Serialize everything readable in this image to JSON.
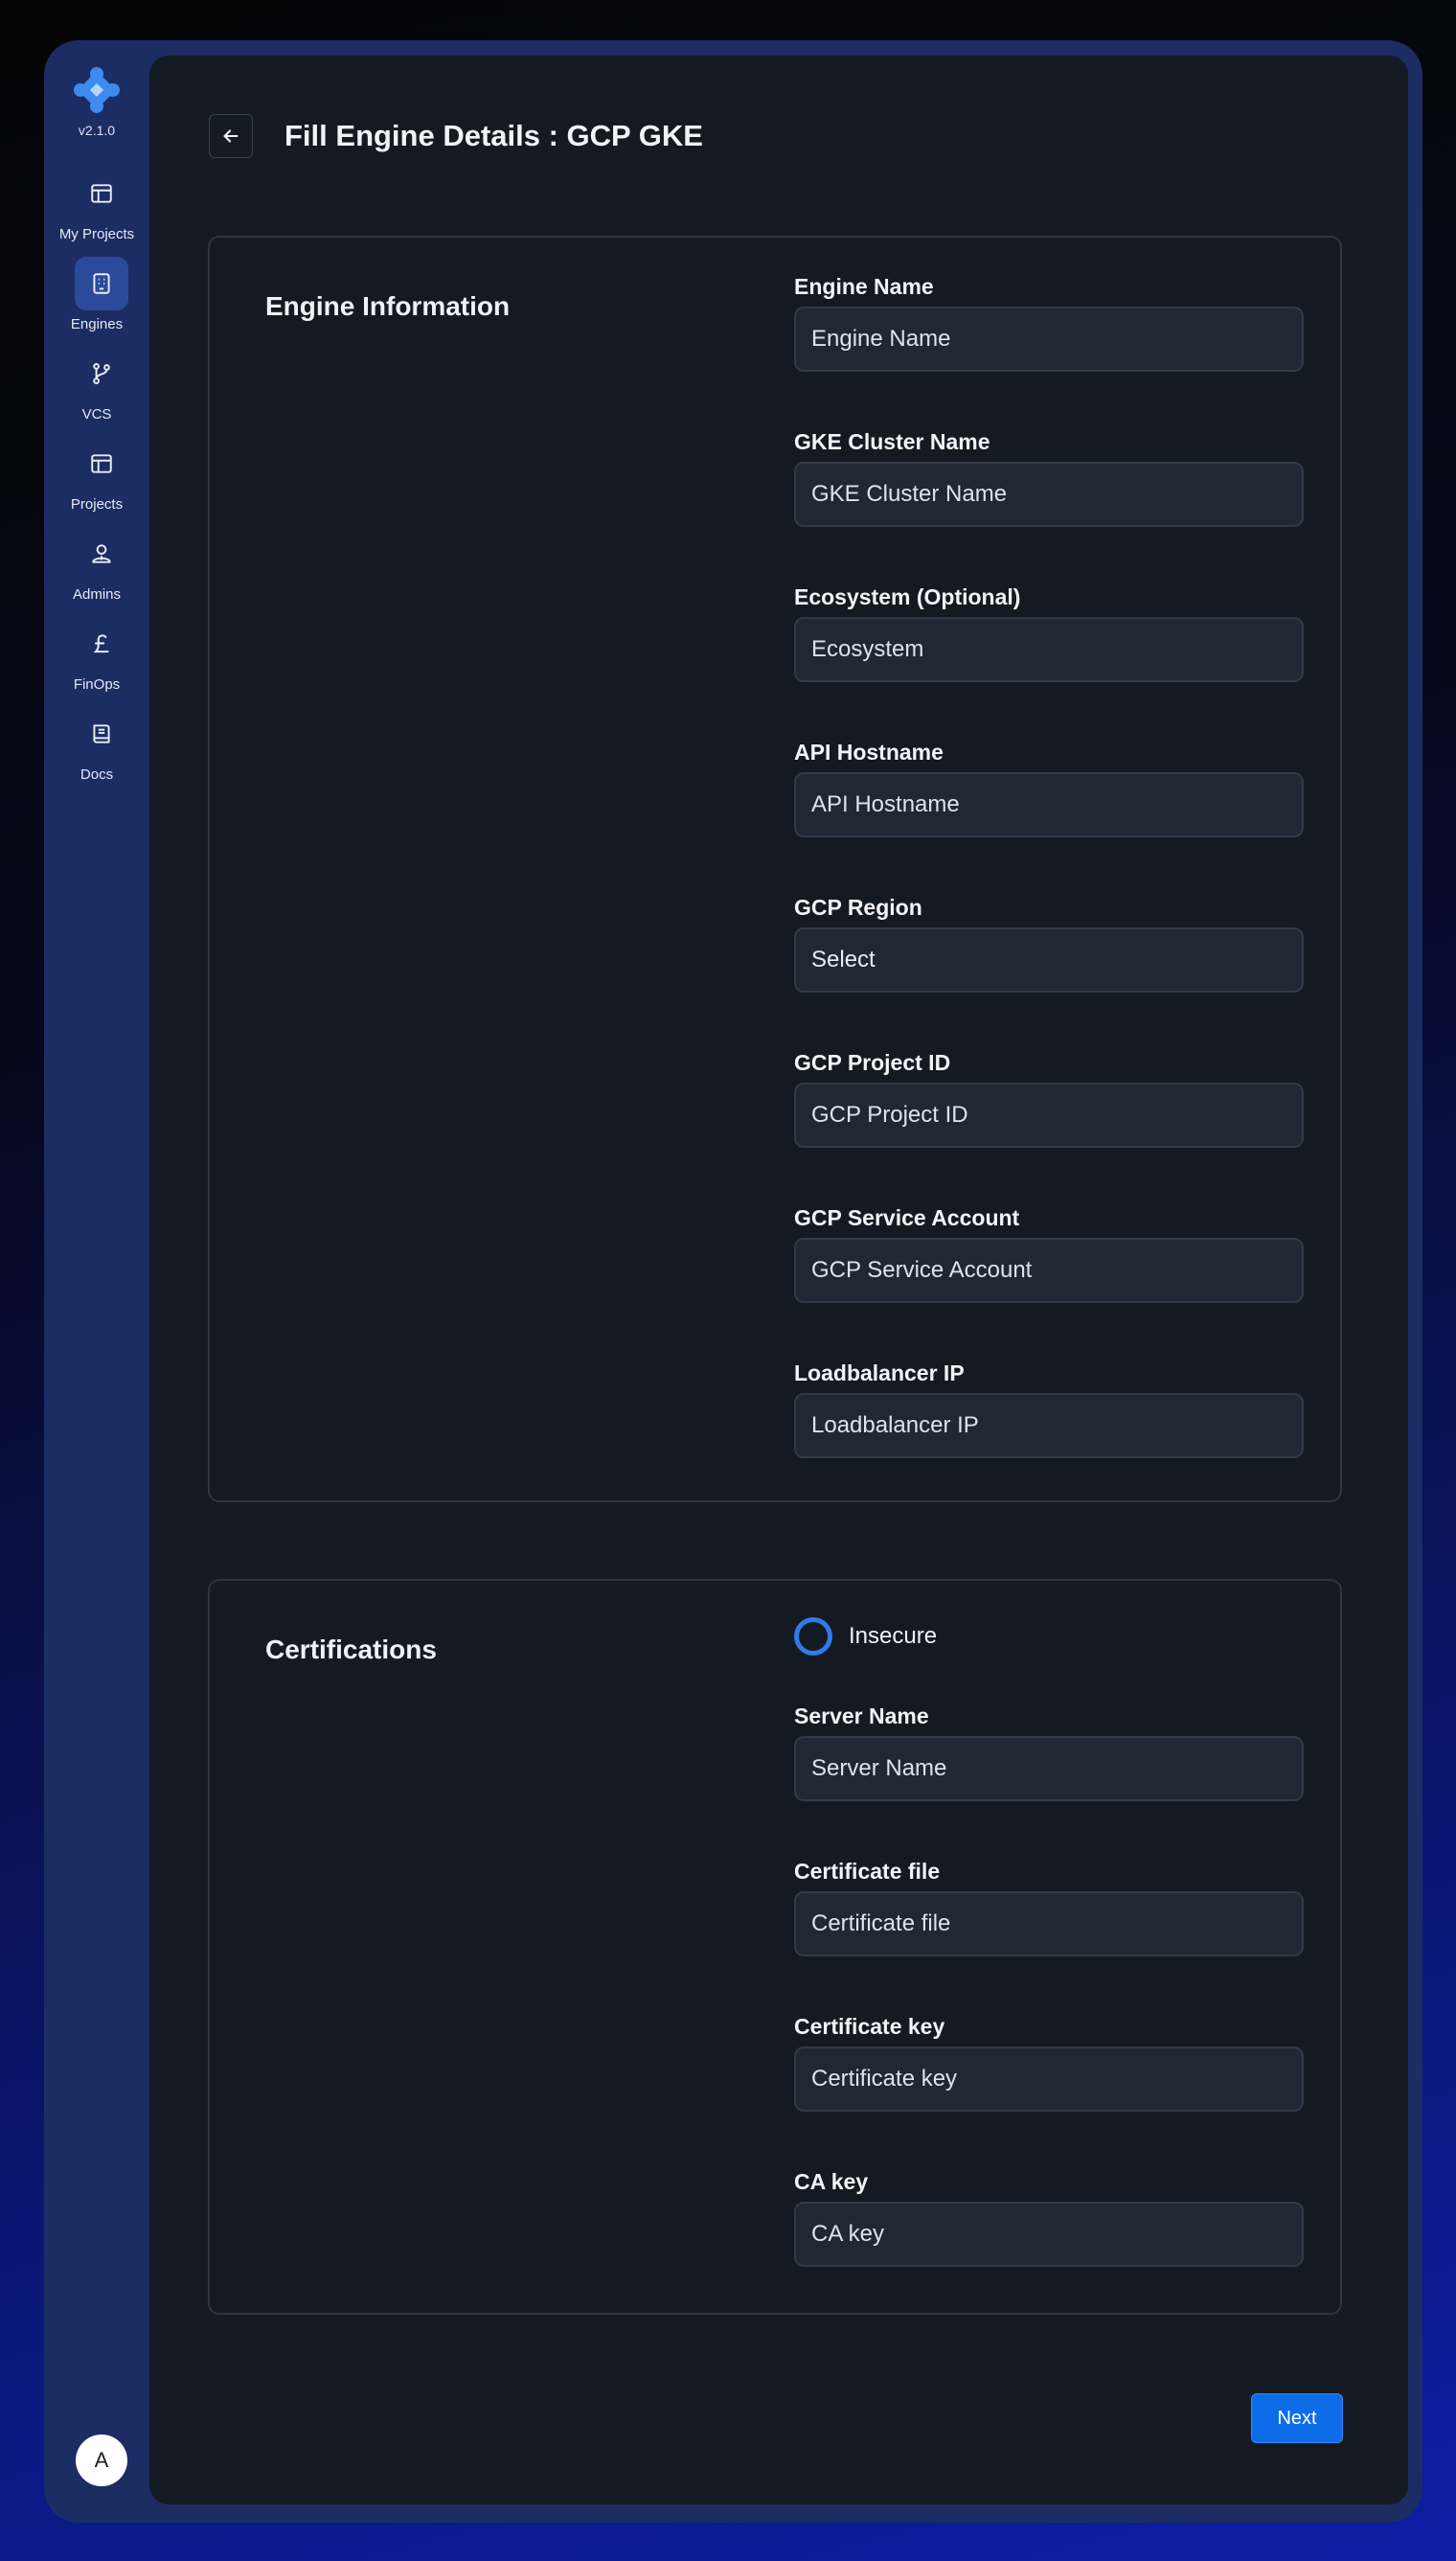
{
  "sidebar": {
    "version": "v2.1.0",
    "items": [
      {
        "label": "My Projects",
        "icon": "layout-icon"
      },
      {
        "label": "Engines",
        "icon": "engine-icon",
        "active": true
      },
      {
        "label": "VCS",
        "icon": "git-branch-icon"
      },
      {
        "label": "Projects",
        "icon": "layout-icon"
      },
      {
        "label": "Admins",
        "icon": "admin-user-icon"
      },
      {
        "label": "FinOps",
        "icon": "pound-icon"
      },
      {
        "label": "Docs",
        "icon": "book-icon"
      }
    ],
    "avatar_initial": "A"
  },
  "header": {
    "title": "Fill Engine Details : GCP GKE"
  },
  "engine_info": {
    "title": "Engine Information",
    "fields": [
      {
        "label": "Engine Name",
        "placeholder": "Engine Name",
        "value": ""
      },
      {
        "label": "GKE Cluster Name",
        "placeholder": "GKE Cluster Name",
        "value": ""
      },
      {
        "label": "Ecosystem (Optional)",
        "placeholder": "Ecosystem",
        "value": ""
      },
      {
        "label": "API Hostname",
        "placeholder": "API Hostname",
        "value": ""
      },
      {
        "label": "GCP Region",
        "placeholder": "Select",
        "value": "Select"
      },
      {
        "label": "GCP Project ID",
        "placeholder": "GCP Project ID",
        "value": ""
      },
      {
        "label": "GCP Service Account",
        "placeholder": "GCP Service Account",
        "value": ""
      },
      {
        "label": "Loadbalancer IP",
        "placeholder": "Loadbalancer IP",
        "value": ""
      }
    ]
  },
  "certifications": {
    "title": "Certifications",
    "insecure_label": "Insecure",
    "fields": [
      {
        "label": "Server Name",
        "placeholder": "Server Name",
        "value": ""
      },
      {
        "label": "Certificate file",
        "placeholder": "Certificate file",
        "value": ""
      },
      {
        "label": "Certificate key",
        "placeholder": "Certificate key",
        "value": ""
      },
      {
        "label": "CA key",
        "placeholder": "CA key",
        "value": ""
      }
    ]
  },
  "actions": {
    "next_label": "Next"
  },
  "colors": {
    "accent": "#2f7bea",
    "sidebar": "#1b2d63",
    "panel": "#141a22",
    "input_bg": "#202833",
    "next_button": "#0d6de9"
  }
}
